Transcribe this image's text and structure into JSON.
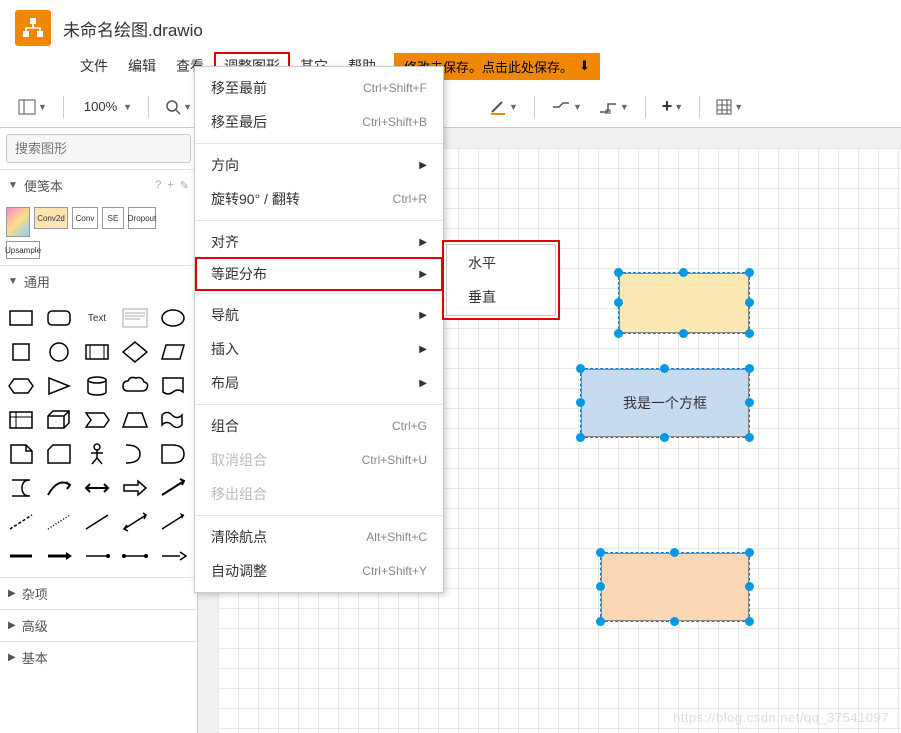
{
  "app": {
    "title": "未命名绘图.drawio"
  },
  "menubar": {
    "items": [
      "文件",
      "编辑",
      "查看",
      "调整图形",
      "其它",
      "帮助"
    ],
    "highlighted_index": 3,
    "save_notice": "修改未保存。点击此处保存。"
  },
  "toolbar": {
    "zoom": "100%"
  },
  "sidebar": {
    "search_placeholder": "搜索图形",
    "palettes": {
      "scratchpad": {
        "label": "便笺本",
        "hints": [
          "?",
          "+",
          "✎"
        ]
      },
      "general": {
        "label": "通用"
      },
      "misc": {
        "label": "杂项"
      },
      "advanced": {
        "label": "高级"
      },
      "basic": {
        "label": "基本"
      }
    },
    "scratch_items": [
      "",
      "Conv2d",
      "Conv",
      "SE",
      "Dropout",
      "Upsample"
    ]
  },
  "dropdown": {
    "items": [
      {
        "label": "移至最前",
        "shortcut": "Ctrl+Shift+F"
      },
      {
        "label": "移至最后",
        "shortcut": "Ctrl+Shift+B"
      },
      {
        "sep": true
      },
      {
        "label": "方向",
        "submenu": true
      },
      {
        "label": "旋转90° / 翻转",
        "shortcut": "Ctrl+R"
      },
      {
        "sep": true
      },
      {
        "label": "对齐",
        "submenu": true
      },
      {
        "label": "等距分布",
        "submenu": true,
        "highlighted": true
      },
      {
        "sep": true
      },
      {
        "label": "导航",
        "submenu": true
      },
      {
        "label": "插入",
        "submenu": true
      },
      {
        "label": "布局",
        "submenu": true
      },
      {
        "sep": true
      },
      {
        "label": "组合",
        "shortcut": "Ctrl+G"
      },
      {
        "label": "取消组合",
        "shortcut": "Ctrl+Shift+U",
        "disabled": true
      },
      {
        "label": "移出组合",
        "disabled": true
      },
      {
        "sep": true
      },
      {
        "label": "清除航点",
        "shortcut": "Alt+Shift+C"
      },
      {
        "label": "自动调整",
        "shortcut": "Ctrl+Shift+Y"
      }
    ]
  },
  "submenu": {
    "items": [
      "水平",
      "垂直"
    ]
  },
  "canvas": {
    "shapes": [
      {
        "fill": "#fce8b2",
        "text": ""
      },
      {
        "fill": "#c6dbf0",
        "text": "我是一个方框"
      },
      {
        "fill": "#fad7b5",
        "text": ""
      }
    ]
  },
  "watermark": "https://blog.csdn.net/qq_37541097"
}
